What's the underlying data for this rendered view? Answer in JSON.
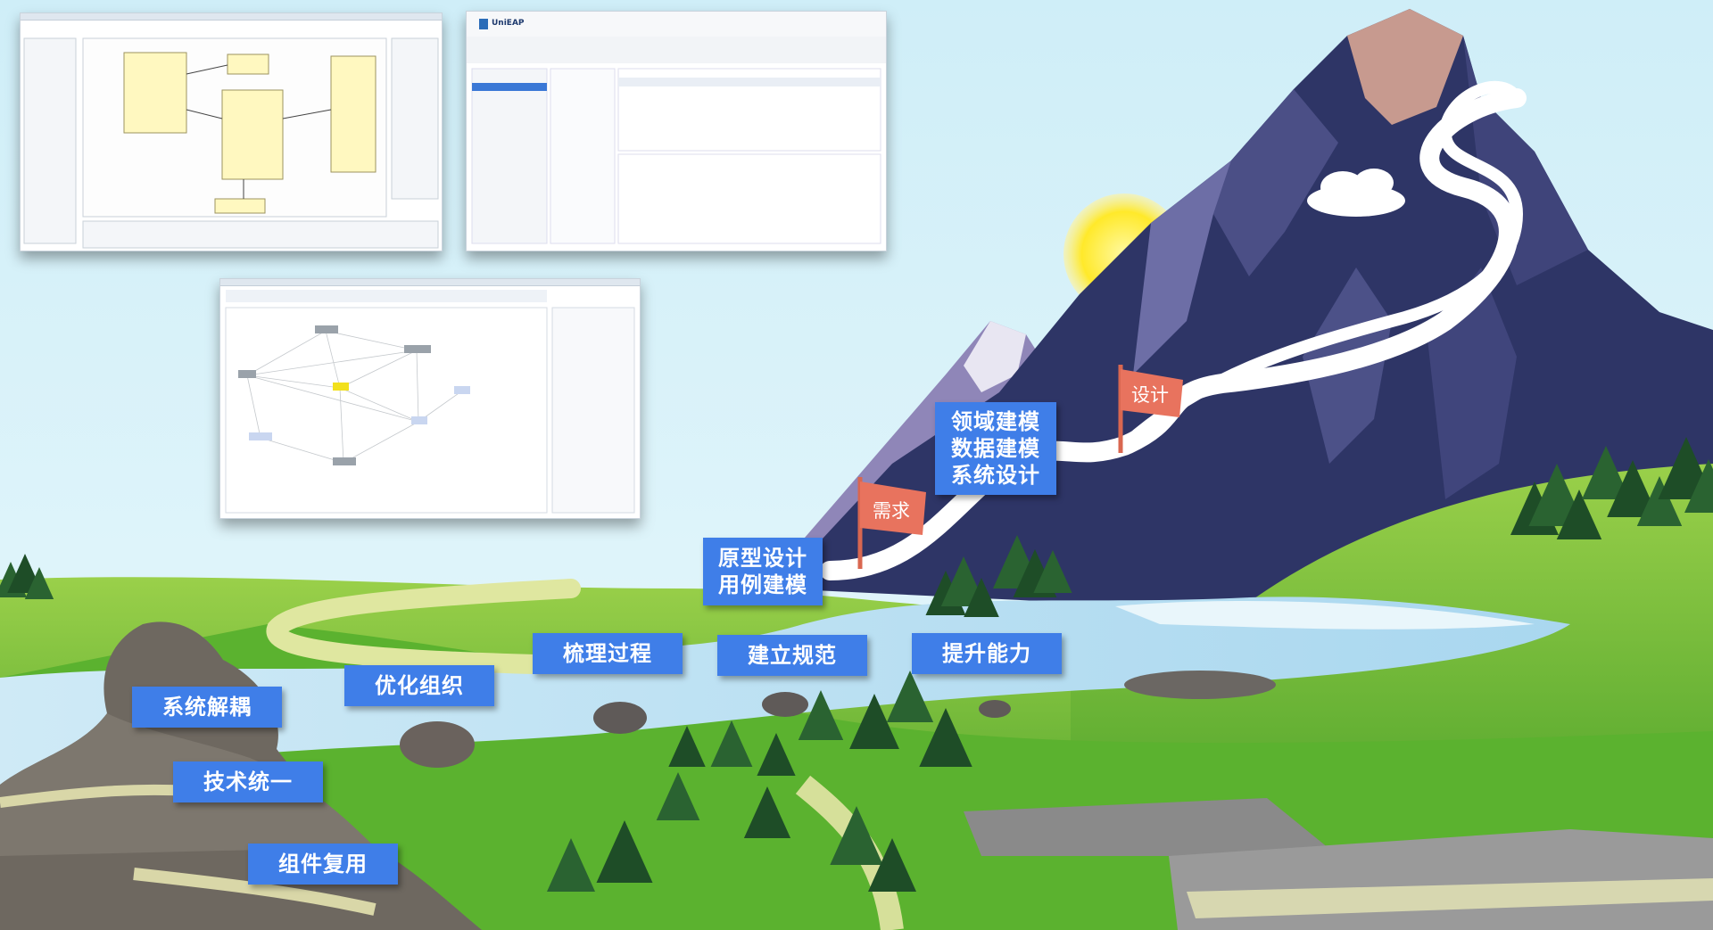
{
  "screenshots": {
    "uml_editor": {},
    "unieap_console": {
      "logo_text": "UniEAP"
    },
    "dependency_graph": {}
  },
  "flags": {
    "requirement": "需求",
    "design": "设计"
  },
  "mountain_labels": {
    "prototype": [
      "原型设计",
      "用例建模"
    ],
    "modeling": [
      "领域建模",
      "数据建模",
      "系统设计"
    ]
  },
  "river_labels": {
    "sort_process": "梳理过程",
    "establish_standard": "建立规范",
    "improve_capability": "提升能力",
    "optimize_org": "优化组织"
  },
  "rock_labels": {
    "decouple": "系统解耦",
    "unify_tech": "技术统一",
    "reuse_components": "组件复用"
  },
  "colors": {
    "label_blue": "#3f7ee8",
    "flag_salmon": "#e8735e",
    "sky": "#d6f2f8",
    "mountain_dark": "#2e3566",
    "grass": "#6cc23a"
  }
}
